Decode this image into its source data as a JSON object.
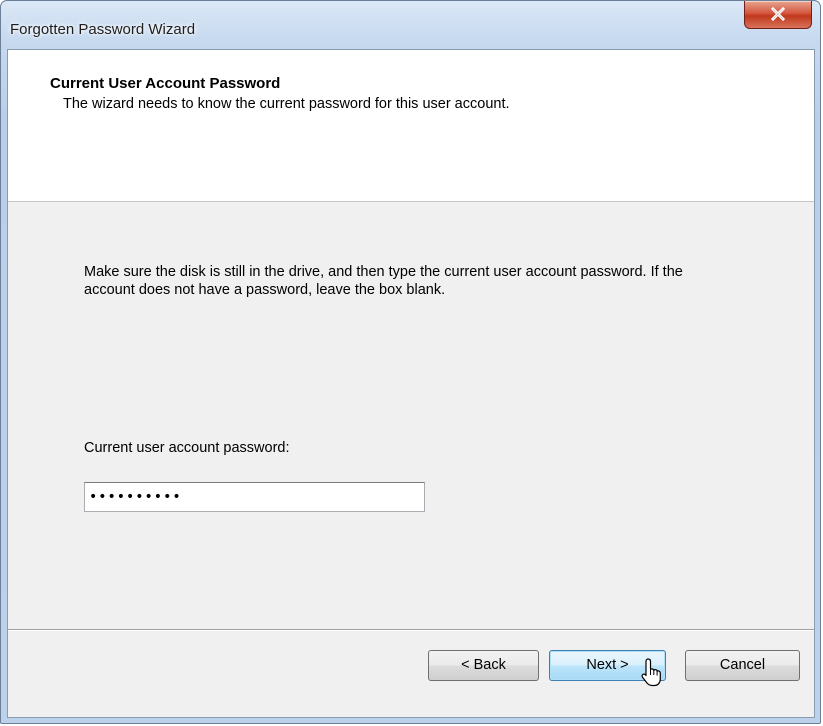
{
  "window": {
    "title": "Forgotten Password Wizard",
    "close_glyph": "X"
  },
  "header": {
    "title": "Current User Account Password",
    "subtitle": "The wizard needs to know the current password for this user account."
  },
  "body": {
    "instructions": "Make sure the disk is still in the drive, and then type the current user account password. If the account does not have a password, leave the box blank.",
    "password_label": "Current user account password:",
    "password_value": "••••••••••"
  },
  "buttons": {
    "back": "< Back",
    "next": "Next >",
    "cancel": "Cancel"
  },
  "icons": {
    "close": "close-icon",
    "cursor": "mouse-pointer-icon"
  },
  "colors": {
    "close_button": "#c7422a",
    "next_button_border": "#3c7fb1",
    "header_background": "#ffffff",
    "body_background": "#f0f0f0"
  }
}
